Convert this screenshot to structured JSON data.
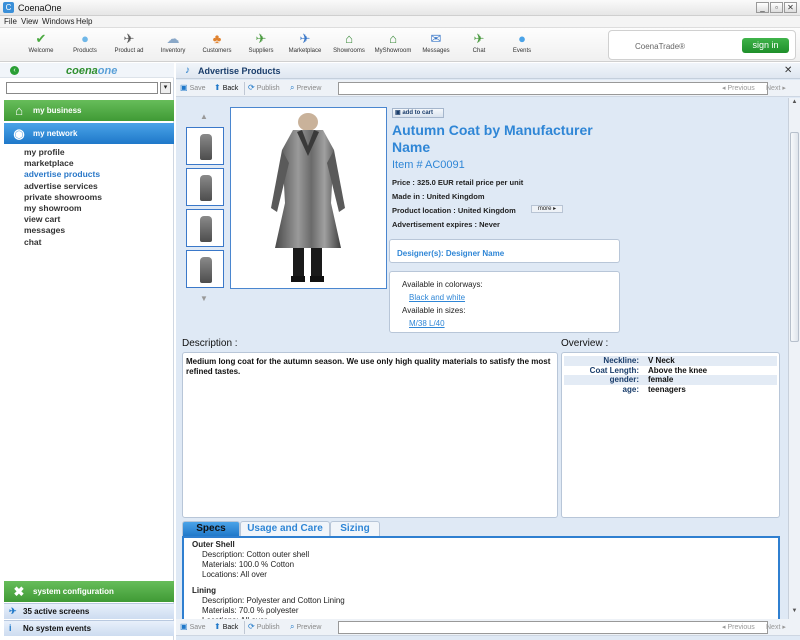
{
  "window": {
    "title": "CoenaOne",
    "app_icon": "C"
  },
  "menu": [
    "File",
    "View",
    "Windows",
    "Help"
  ],
  "toolbar": [
    {
      "label": "Welcome",
      "icon": "welcome-icon",
      "glyph": "✔",
      "color": "#4aa940"
    },
    {
      "label": "Products",
      "icon": "products-icon",
      "glyph": "●",
      "color": "#6fb7e8"
    },
    {
      "label": "Product ad",
      "icon": "product-ad-icon",
      "glyph": "✈",
      "color": "#555"
    },
    {
      "label": "Inventory",
      "icon": "inventory-icon",
      "glyph": "☁",
      "color": "#8aa8c8"
    },
    {
      "label": "Customers",
      "icon": "customers-icon",
      "glyph": "♣",
      "color": "#e0822e"
    },
    {
      "label": "Suppliers",
      "icon": "suppliers-icon",
      "glyph": "✈",
      "color": "#4a9a40"
    },
    {
      "label": "Marketplace",
      "icon": "marketplace-icon",
      "glyph": "✈",
      "color": "#3a78c9"
    },
    {
      "label": "Showrooms",
      "icon": "showrooms-icon",
      "glyph": "⌂",
      "color": "#3a8a3a"
    },
    {
      "label": "MyShowroom",
      "icon": "myshowroom-icon",
      "glyph": "⌂",
      "color": "#3a8a3a"
    },
    {
      "label": "Messages",
      "icon": "messages-icon",
      "glyph": "✉",
      "color": "#3a78c9"
    },
    {
      "label": "Chat",
      "icon": "chat-icon",
      "glyph": "✈",
      "color": "#4a9a40"
    },
    {
      "label": "Events",
      "icon": "events-icon",
      "glyph": "●",
      "color": "#4aa3e8"
    }
  ],
  "trade": {
    "label": "CoenaTrade®",
    "signin": "sign in"
  },
  "sidebar": {
    "logo_a": "coena",
    "logo_b": "one",
    "business": "my business",
    "network": "my network",
    "items": [
      {
        "label": "my profile",
        "active": false
      },
      {
        "label": "marketplace",
        "active": false
      },
      {
        "label": "advertise products",
        "active": true
      },
      {
        "label": "advertise services",
        "active": false
      },
      {
        "label": "private showrooms",
        "active": false
      },
      {
        "label": "my showroom",
        "active": false
      },
      {
        "label": "view cart",
        "active": false
      },
      {
        "label": "messages",
        "active": false
      },
      {
        "label": "chat",
        "active": false
      }
    ],
    "system_configuration": "system configuration",
    "active_screens": "35 active screens",
    "system_events": "No system events"
  },
  "main": {
    "title": "Advertise Products",
    "actions": {
      "save": "Save",
      "back": "Back",
      "publish": "Publish",
      "preview": "Preview",
      "previous": "Previous",
      "next": "Next"
    },
    "add_to_cart": "add to cart",
    "product_title": "Autumn Coat by Manufacturer Name",
    "item": "Item # AC0091",
    "price": "Price : 325.0 EUR retail price per unit",
    "made_in": "Made in : United Kingdom",
    "location": "Product location : United Kingdom",
    "more": "more ▸",
    "expires": "Advertisement expires : Never",
    "designer": "Designer(s): Designer Name",
    "colorways_label": "Available in colorways:",
    "colorways_value": "Black and white",
    "sizes_label": "Available in sizes:",
    "sizes_value": "M/38  L/40",
    "description_label": "Description :",
    "description": "Medium long coat for the autumn season. We use only high quality materials to satisfy the most refined tastes.",
    "overview_label": "Overview :",
    "overview": [
      {
        "key": "Neckline:",
        "value": "V Neck"
      },
      {
        "key": "Coat Length:",
        "value": "Above the knee"
      },
      {
        "key": "gender:",
        "value": "female"
      },
      {
        "key": "age:",
        "value": "teenagers"
      }
    ],
    "tabs": [
      "Specs",
      "Usage and Care",
      "Sizing"
    ],
    "specs": {
      "outer_title": "Outer Shell",
      "outer_desc": "Description: Cotton outer shell",
      "outer_mat": "Materials: 100.0 % Cotton",
      "outer_loc": "Locations: All over",
      "lining_title": "Lining",
      "lining_desc": "Description: Polyester and Cotton Lining",
      "lining_mat": "Materials: 70.0 % polyester",
      "lining_loc": "Locations: All over"
    }
  }
}
